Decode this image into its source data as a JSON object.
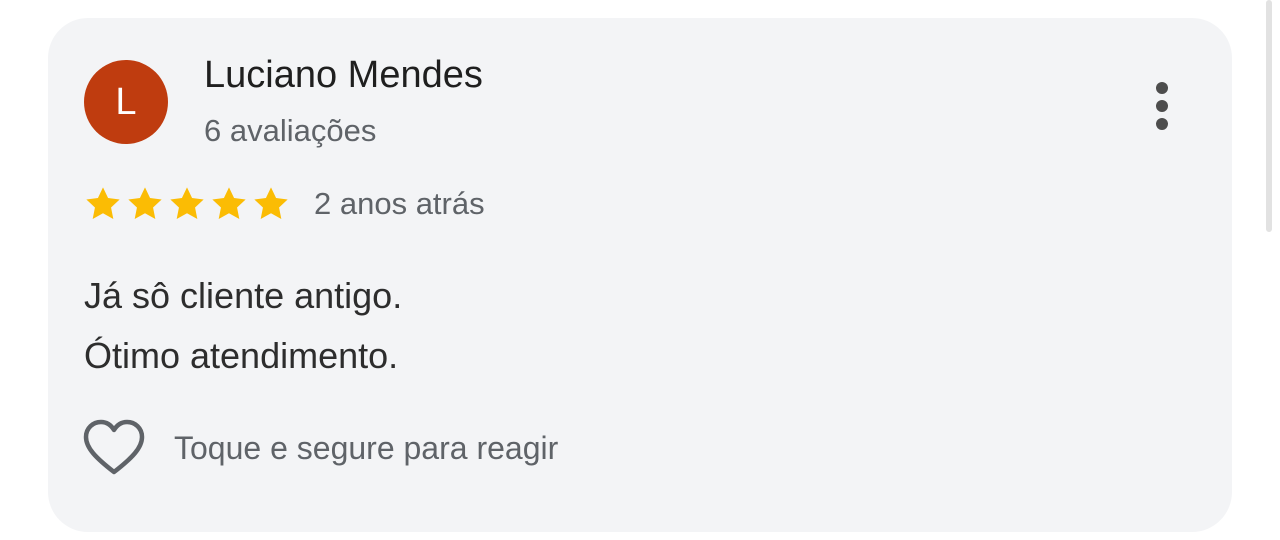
{
  "review": {
    "author": {
      "initial": "L",
      "name": "Luciano Mendes",
      "reviews_count": "6 avaliações",
      "avatar_color": "#bf3c0f"
    },
    "rating": {
      "stars": 5,
      "max_stars": 5,
      "star_color": "#fbbc04"
    },
    "date": "2 anos atrás",
    "text_lines": [
      "Já sô cliente antigo.",
      "Ótimo atendimento."
    ],
    "reaction": {
      "icon": "heart-outline-icon",
      "label": "Toque e segure para reagir"
    },
    "menu_icon": "more-vertical-icon"
  }
}
